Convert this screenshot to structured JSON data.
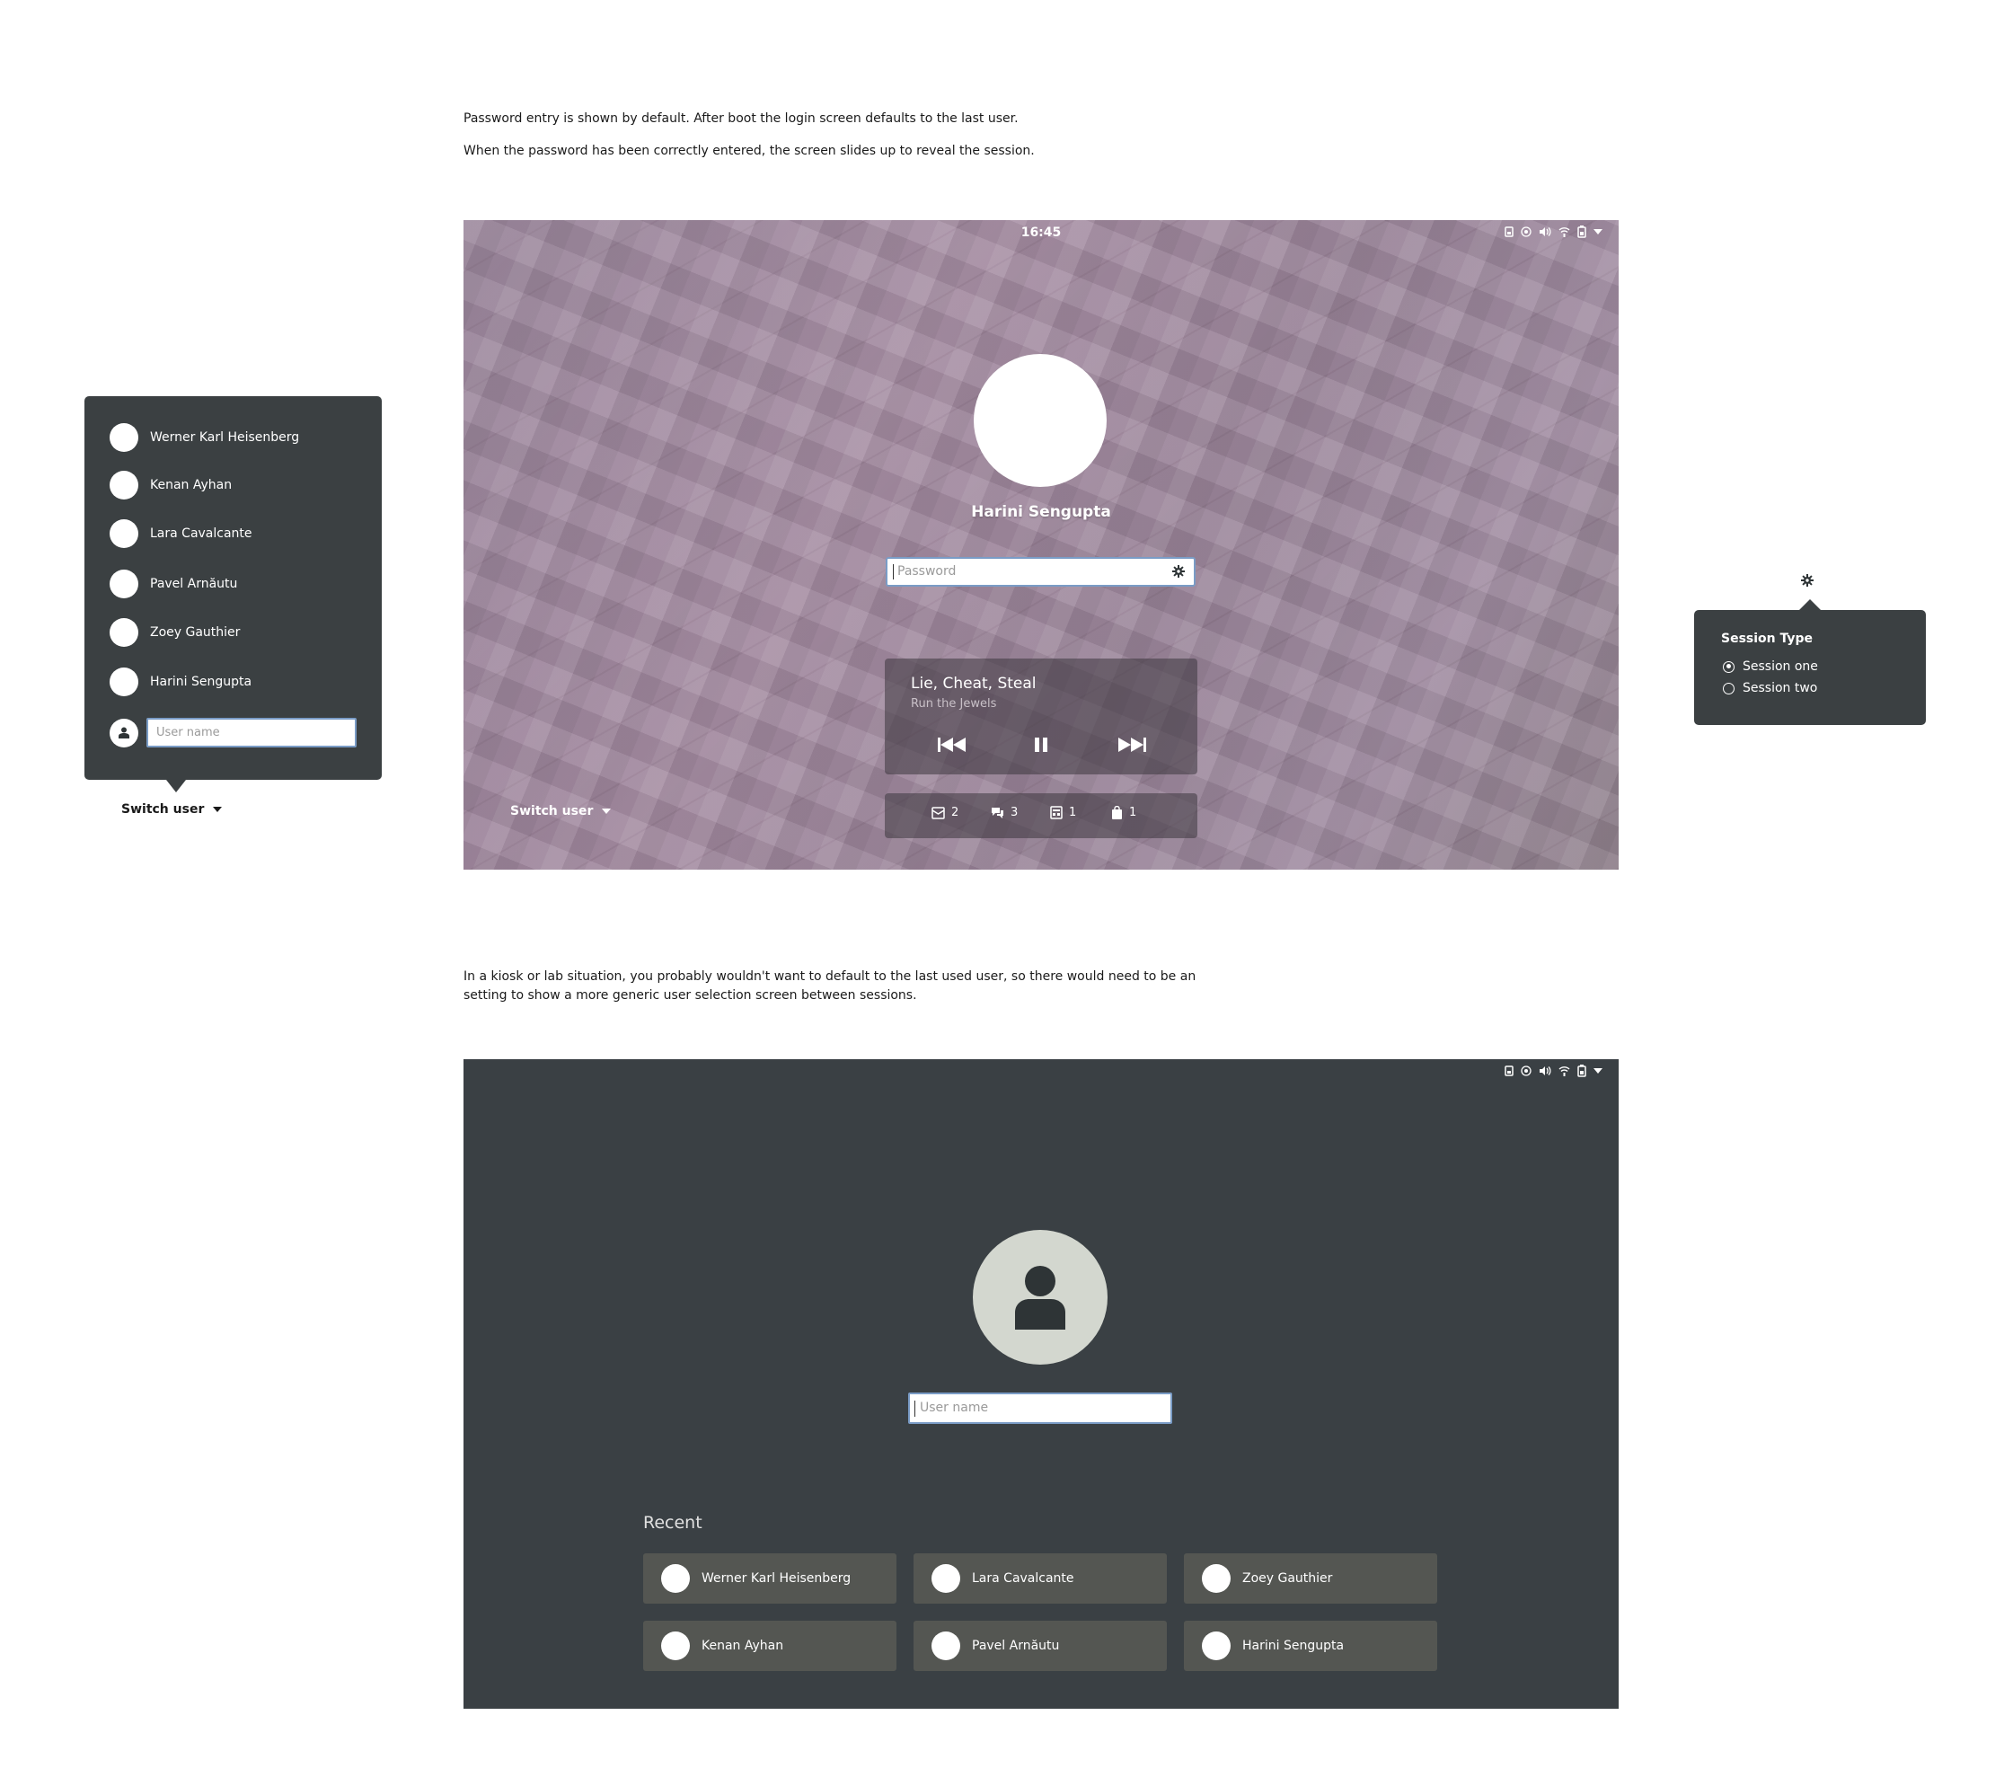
{
  "notes": {
    "line1": "Password entry is shown by default. After boot the login screen defaults to the last user.",
    "line2": "When the password has been correctly entered, the screen slides up to reveal the session.",
    "kiosk_line1": "In a kiosk or lab situation, you probably wouldn't want to default to the last used user, so there would need to be an",
    "kiosk_line2": "setting to show a more generic user selection screen between sessions."
  },
  "lock_screen": {
    "clock": "16:45",
    "status_icons": [
      "battery-small-icon",
      "accessibility-icon",
      "volume-icon",
      "wifi-icon",
      "battery-icon",
      "dropdown-arrow-icon"
    ],
    "user_name": "Harini Sengupta",
    "password_placeholder": "Password",
    "media": {
      "title": "Lie, Cheat, Steal",
      "artist": "Run the Jewels"
    },
    "notifications": [
      {
        "icon": "email-icon",
        "count": "2"
      },
      {
        "icon": "chat-icon",
        "count": "3"
      },
      {
        "icon": "calendar-icon",
        "count": "1"
      },
      {
        "icon": "shopping-bag-icon",
        "count": "1"
      }
    ],
    "switch_user": "Switch user"
  },
  "user_popover": {
    "users": [
      "Werner Karl Heisenberg",
      "Kenan Ayhan",
      "Lara Cavalcante",
      "Pavel Arnăutu",
      "Zoey Gauthier",
      "Harini Sengupta"
    ],
    "username_placeholder": "User name",
    "switch_user": "Switch user"
  },
  "session_popover": {
    "title": "Session Type",
    "options": [
      "Session one",
      "Session two"
    ],
    "selected": "Session one"
  },
  "select_screen": {
    "username_placeholder": "User name",
    "recent_label": "Recent",
    "recent_users": [
      "Werner Karl Heisenberg",
      "Lara Cavalcante",
      "Zoey Gauthier",
      "Kenan Ayhan",
      "Pavel Arnăutu",
      "Harini Sengupta"
    ]
  },
  "colors": {
    "popover_bg": "#3b4042",
    "screen2_bg": "#3a4044",
    "card_bg": "#545652",
    "field_border": "#7a9cc6"
  }
}
